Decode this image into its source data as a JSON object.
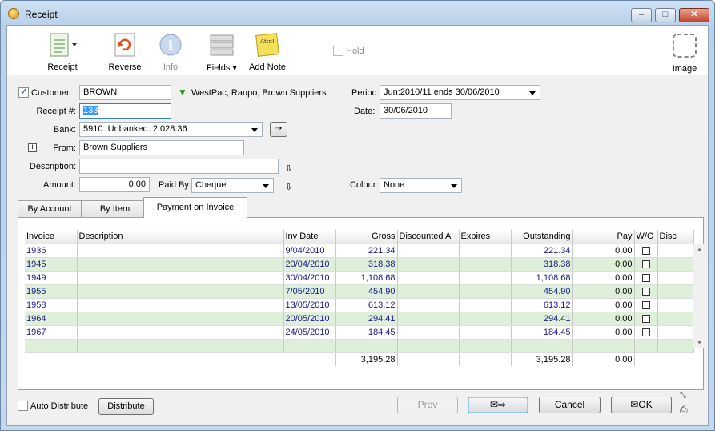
{
  "window": {
    "title": "Receipt"
  },
  "toolbar": {
    "receipt": "Receipt",
    "reverse": "Reverse",
    "info": "Info",
    "fields": "Fields",
    "add_note": "Add Note",
    "note_text": "Attn!",
    "hold": "Hold",
    "image": "Image"
  },
  "form": {
    "customer_label": "Customer:",
    "customer_value": "BROWN",
    "customer_desc": "WestPac, Raupo, Brown Suppliers",
    "receipt_label": "Receipt #:",
    "receipt_value": "133",
    "bank_label": "Bank:",
    "bank_value": "5910: Unbanked: 2,028.36",
    "from_label": "From:",
    "from_value": "Brown Suppliers",
    "description_label": "Description:",
    "description_value": "",
    "amount_label": "Amount:",
    "amount_value": "0.00",
    "paidby_label": "Paid By:",
    "paidby_value": "Cheque",
    "period_label": "Period:",
    "period_value": "Jun:2010/11 ends 30/06/2010",
    "date_label": "Date:",
    "date_value": "30/06/2010",
    "colour_label": "Colour:",
    "colour_value": "None",
    "expand_glyph": "+"
  },
  "tabs": [
    "By Account",
    "By Item",
    "Payment on Invoice"
  ],
  "grid": {
    "headers": [
      "Invoice",
      "Description",
      "Inv Date",
      "Gross",
      "Discounted A",
      "Expires",
      "Outstanding",
      "Pay",
      "W/O",
      "Disc"
    ],
    "rows": [
      {
        "invoice": "1936",
        "desc": "",
        "date": "9/04/2010",
        "gross": "221.34",
        "disc": "",
        "expires": "",
        "outstanding": "221.34",
        "pay": "0.00"
      },
      {
        "invoice": "1945",
        "desc": "",
        "date": "20/04/2010",
        "gross": "318.38",
        "disc": "",
        "expires": "",
        "outstanding": "318.38",
        "pay": "0.00"
      },
      {
        "invoice": "1949",
        "desc": "",
        "date": "30/04/2010",
        "gross": "1,108.68",
        "disc": "",
        "expires": "",
        "outstanding": "1,108.68",
        "pay": "0.00"
      },
      {
        "invoice": "1955",
        "desc": "",
        "date": "7/05/2010",
        "gross": "454.90",
        "disc": "",
        "expires": "",
        "outstanding": "454.90",
        "pay": "0.00"
      },
      {
        "invoice": "1958",
        "desc": "",
        "date": "13/05/2010",
        "gross": "613.12",
        "disc": "",
        "expires": "",
        "outstanding": "613.12",
        "pay": "0.00"
      },
      {
        "invoice": "1964",
        "desc": "",
        "date": "20/05/2010",
        "gross": "294.41",
        "disc": "",
        "expires": "",
        "outstanding": "294.41",
        "pay": "0.00"
      },
      {
        "invoice": "1967",
        "desc": "",
        "date": "24/05/2010",
        "gross": "184.45",
        "disc": "",
        "expires": "",
        "outstanding": "184.45",
        "pay": "0.00"
      }
    ],
    "totals": {
      "gross": "3,195.28",
      "outstanding": "3,195.28",
      "pay": "0.00"
    }
  },
  "footer": {
    "auto_distribute": "Auto Distribute",
    "distribute": "Distribute",
    "prev": "Prev",
    "cancel": "Cancel",
    "ok": "OK"
  },
  "colors": {
    "row_alt": "#dff0da",
    "link_text": "#1a1a8a",
    "note_yellow": "#f5e05a"
  }
}
